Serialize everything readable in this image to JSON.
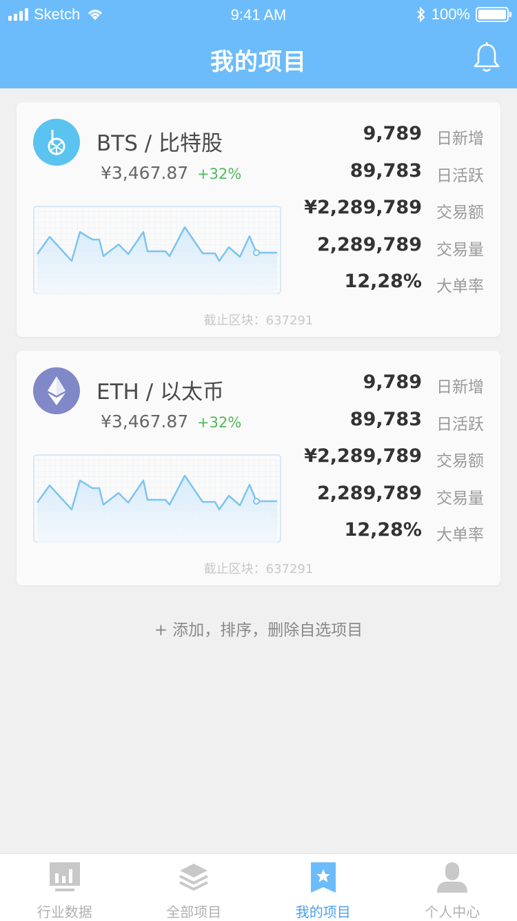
{
  "status_bar": {
    "carrier": "Sketch",
    "time": "9:41 AM",
    "battery": "100%"
  },
  "header": {
    "title": "我的项目",
    "icon": "bell-icon"
  },
  "cards": [
    {
      "name": "BTS / 比特股",
      "price": "¥3,467.87",
      "change": "+32%",
      "logo_color": "#5bc3ef",
      "logo_icon": "bitshares-icon",
      "stats": [
        {
          "value": "9,789",
          "label": "日新增"
        },
        {
          "value": "89,783",
          "label": "日活跃"
        },
        {
          "value": "¥2,289,789",
          "label": "交易额"
        },
        {
          "value": "2,289,789",
          "label": "交易量"
        },
        {
          "value": "12,28%",
          "label": "大单率"
        }
      ],
      "block": "截止区块：637291"
    },
    {
      "name": "ETH / 以太币",
      "price": "¥3,467.87",
      "change": "+32%",
      "logo_color": "#8088c8",
      "logo_icon": "ethereum-icon",
      "stats": [
        {
          "value": "9,789",
          "label": "日新增"
        },
        {
          "value": "89,783",
          "label": "日活跃"
        },
        {
          "value": "¥2,289,789",
          "label": "交易额"
        },
        {
          "value": "2,289,789",
          "label": "交易量"
        },
        {
          "value": "12,28%",
          "label": "大单率"
        }
      ],
      "block": "截止区块：637291"
    }
  ],
  "add_link": "+ 添加，排序，删除自选项目",
  "tabbar": [
    {
      "label": "行业数据",
      "icon": "bar-chart-icon",
      "active": false
    },
    {
      "label": "全部项目",
      "icon": "layers-icon",
      "active": false
    },
    {
      "label": "我的项目",
      "icon": "star-bookmark-icon",
      "active": true
    },
    {
      "label": "个人中心",
      "icon": "user-icon",
      "active": false
    }
  ],
  "colors": {
    "accent": "#6cbcfc",
    "tab_active": "#4a9ff5",
    "positive": "#4fb85a",
    "sparkline": "#7cc4f0"
  }
}
